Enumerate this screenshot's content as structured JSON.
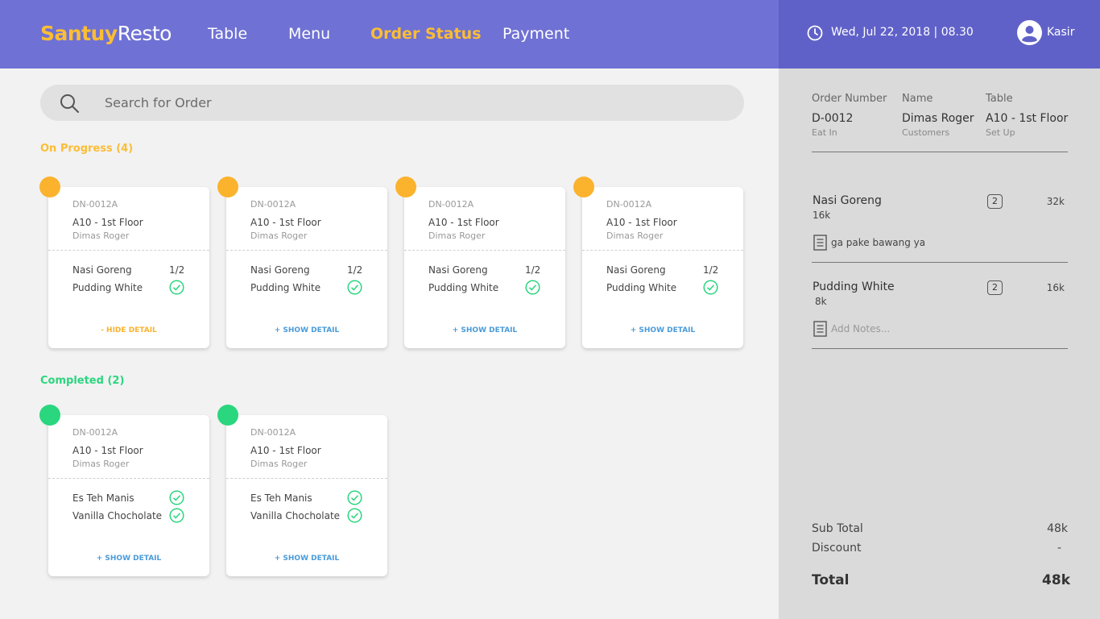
{
  "app": {
    "logo_bold": "Santuy",
    "logo_rest": "Resto"
  },
  "nav": {
    "table": "Table",
    "menu": "Menu",
    "order_status": "Order Status",
    "payment": "Payment"
  },
  "header": {
    "datetime": "Wed, Jul 22, 2018 | 08.30",
    "user": "Kasir"
  },
  "search": {
    "placeholder": "Search for Order"
  },
  "sections": {
    "progress": "On Progress (4)",
    "completed": "Completed (2)"
  },
  "cards_progress": [
    {
      "number": "DN-0012A",
      "table": "A10 - 1st Floor",
      "customer": "Dimas Roger",
      "item1": "Nasi Goreng",
      "item1_status": "1/2",
      "item2": "Pudding White",
      "link": "- HIDE DETAIL"
    },
    {
      "number": "DN-0012A",
      "table": "A10 - 1st Floor",
      "customer": "Dimas Roger",
      "item1": "Nasi Goreng",
      "item1_status": "1/2",
      "item2": "Pudding White",
      "link": "+ SHOW DETAIL"
    },
    {
      "number": "DN-0012A",
      "table": "A10 - 1st Floor",
      "customer": "Dimas Roger",
      "item1": "Nasi Goreng",
      "item1_status": "1/2",
      "item2": "Pudding White",
      "link": "+ SHOW DETAIL"
    },
    {
      "number": "DN-0012A",
      "table": "A10 - 1st Floor",
      "customer": "Dimas Roger",
      "item1": "Nasi Goreng",
      "item1_status": "1/2",
      "item2": "Pudding White",
      "link": "+ SHOW DETAIL"
    }
  ],
  "cards_completed": [
    {
      "number": "DN-0012A",
      "table": "A10 - 1st Floor",
      "customer": "Dimas Roger",
      "item1": "Es Teh Manis",
      "item2": "Vanilla Chocholate",
      "link": "+ SHOW DETAIL"
    },
    {
      "number": "DN-0012A",
      "table": "A10 - 1st Floor",
      "customer": "Dimas Roger",
      "item1": "Es Teh Manis",
      "item2": "Vanilla Chocholate",
      "link": "+ SHOW DETAIL"
    }
  ],
  "detail": {
    "order_number_label": "Order Number",
    "order_number": "D-0012",
    "order_type": "Eat In",
    "name_label": "Name",
    "name": "Dimas Roger",
    "name_sub": "Customers",
    "table_label": "Table",
    "table": "A10 - 1st Floor",
    "table_sub": "Set Up",
    "items": [
      {
        "name": "Nasi Goreng",
        "price": "16k",
        "qty": "2",
        "total": "32k",
        "note": "ga pake bawang ya"
      },
      {
        "name": "Pudding White",
        "price": "8k",
        "qty": "2",
        "total": "16k",
        "note_placeholder": "Add Notes..."
      }
    ],
    "subtotal_label": "Sub Total",
    "subtotal": "48k",
    "discount_label": "Discount",
    "discount": "-",
    "total_label": "Total",
    "total": "48k"
  },
  "colors": {
    "header": "#6f71d4",
    "header_right": "#6061c8",
    "accent": "#fbbd35",
    "progress": "#fbb22d",
    "completed": "#2ad67e",
    "link": "#4a9bd9"
  }
}
